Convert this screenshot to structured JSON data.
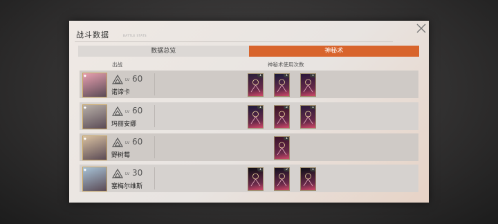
{
  "panel": {
    "title": "战斗数据",
    "subtitle": "BATTLE STATS"
  },
  "tabs": [
    {
      "label": "数据总览",
      "active": false
    },
    {
      "label": "神秘术",
      "active": true
    }
  ],
  "columns": {
    "deployed": "出战",
    "usage": "神秘术使用次数"
  },
  "characters": [
    {
      "name": "诺谛卡",
      "level": "60",
      "lv_prefix": "LV",
      "avatar_color": "#e8a0b0",
      "cards": [
        {
          "count": "1",
          "color": "#2a1f3a"
        },
        {
          "count": "1",
          "color": "#1b1a3a"
        },
        {
          "count": "1",
          "color": "#2a1638"
        }
      ]
    },
    {
      "name": "玛丽安娜",
      "level": "60",
      "lv_prefix": "LV",
      "avatar_color": "#b8b0a8",
      "cards": [
        {
          "count": "1",
          "color": "#1e1a3a"
        },
        {
          "count": "2",
          "color": "#3a1422"
        },
        {
          "count": "1",
          "color": "#2a1a3a"
        }
      ]
    },
    {
      "name": "野树莓",
      "level": "60",
      "lv_prefix": "LV",
      "avatar_color": "#d8c0a0",
      "cards": [
        {
          "count": "1",
          "color": "#3a1228"
        }
      ]
    },
    {
      "name": "塞梅尔维斯",
      "level": "30",
      "lv_prefix": "LV",
      "avatar_color": "#a8c4d8",
      "cards": [
        {
          "count": "1",
          "color": "#0e0e14"
        },
        {
          "count": "2",
          "color": "#141020"
        },
        {
          "count": "1",
          "color": "#101018"
        }
      ]
    }
  ]
}
